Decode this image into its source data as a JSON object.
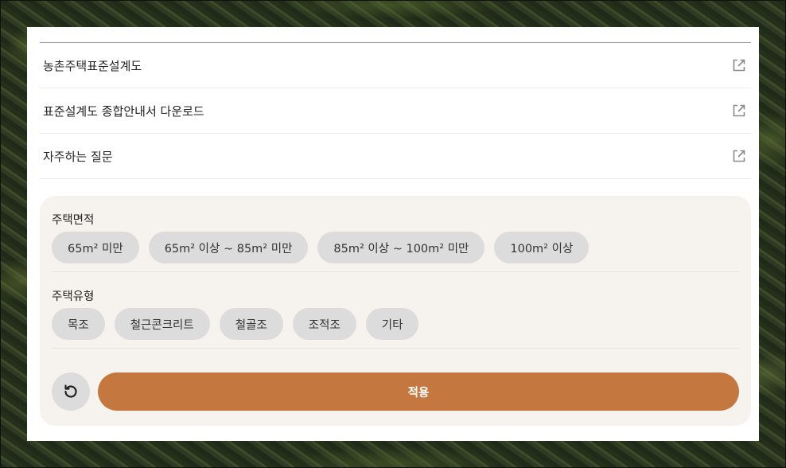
{
  "links": [
    {
      "label": "농촌주택표준설계도",
      "icon": "external-link-icon"
    },
    {
      "label": "표준설계도 종합안내서 다운로드",
      "icon": "external-link-icon"
    },
    {
      "label": "자주하는 질문",
      "icon": "external-link-icon"
    }
  ],
  "filters": {
    "area": {
      "title": "주택면적",
      "options": [
        "65m² 미만",
        "65m² 이상 ~ 85m² 미만",
        "85m² 이상 ~ 100m² 미만",
        "100m² 이상"
      ]
    },
    "type": {
      "title": "주택유형",
      "options": [
        "목조",
        "철근콘크리트",
        "철골조",
        "조적조",
        "기타"
      ]
    }
  },
  "actions": {
    "reset_icon": "reset-icon",
    "apply_label": "적용"
  },
  "colors": {
    "accent": "#c4773f",
    "panel_bg": "#f6f2ed",
    "chip_bg": "#dcdcdc"
  }
}
